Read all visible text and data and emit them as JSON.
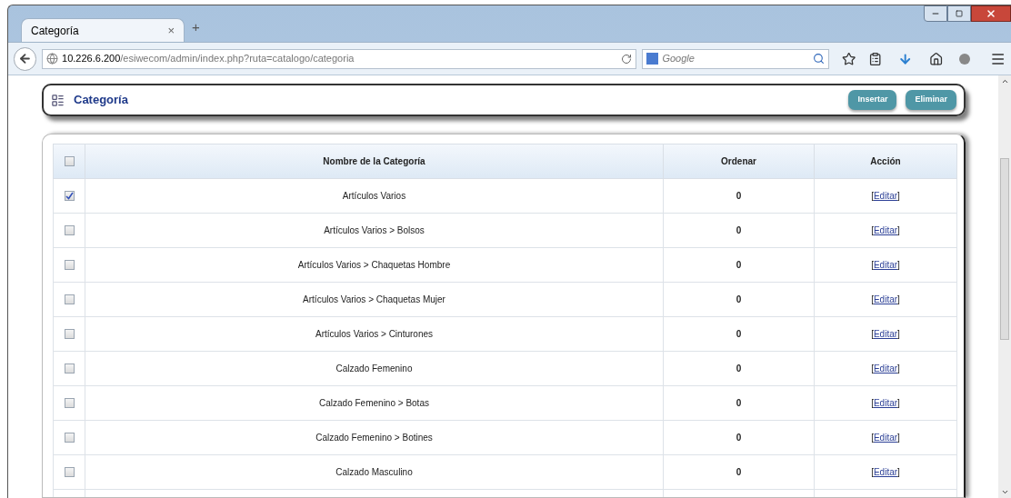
{
  "browser": {
    "tab": {
      "title": "Categoría",
      "close": "×"
    },
    "new_tab": "+",
    "address": {
      "host": "10.226.6.200",
      "path": "/esiwecom/admin/index.php?ruta=catalogo/categoria"
    },
    "search": {
      "placeholder": "Google"
    }
  },
  "panel": {
    "title": "Categoría",
    "buttons": [
      "Insertar",
      "Eliminar"
    ]
  },
  "table": {
    "columns": [
      "Nombre de la Categoría",
      "Ordenar",
      "Acción"
    ],
    "header_checked": false,
    "rows": [
      {
        "checked": true,
        "name": "Artículos Varios",
        "order": "0",
        "action": {
          "open": "[",
          "link": "Editar",
          "close": "]"
        }
      },
      {
        "checked": false,
        "name": "Artículos Varios > Bolsos",
        "order": "0",
        "action": {
          "open": "[",
          "link": "Editar",
          "close": "]"
        }
      },
      {
        "checked": false,
        "name": "Artículos Varios > Chaquetas Hombre",
        "order": "0",
        "action": {
          "open": "[",
          "link": "Editar",
          "close": "]"
        }
      },
      {
        "checked": false,
        "name": "Artículos Varios > Chaquetas Mujer",
        "order": "0",
        "action": {
          "open": "[",
          "link": "Editar",
          "close": "]"
        }
      },
      {
        "checked": false,
        "name": "Artículos Varios > Cinturones",
        "order": "0",
        "action": {
          "open": "[",
          "link": "Editar",
          "close": "]"
        }
      },
      {
        "checked": false,
        "name": "Calzado Femenino",
        "order": "0",
        "action": {
          "open": "[",
          "link": "Editar",
          "close": "]"
        }
      },
      {
        "checked": false,
        "name": "Calzado Femenino > Botas",
        "order": "0",
        "action": {
          "open": "[",
          "link": "Editar",
          "close": "]"
        }
      },
      {
        "checked": false,
        "name": "Calzado Femenino > Botines",
        "order": "0",
        "action": {
          "open": "[",
          "link": "Editar",
          "close": "]"
        }
      },
      {
        "checked": false,
        "name": "Calzado Masculino",
        "order": "0",
        "action": {
          "open": "[",
          "link": "Editar",
          "close": "]"
        }
      }
    ]
  }
}
